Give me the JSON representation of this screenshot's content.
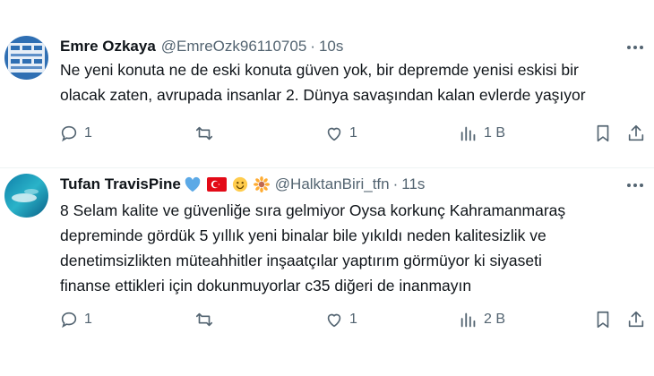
{
  "tweets": [
    {
      "name": "Emre Ozkaya",
      "handle": "@EmreOzk96110705",
      "separator": "·",
      "time": "10s",
      "lines": [
        "Ne yeni konuta ne de eski konuta güven yok, bir depremde yenisi eskisi bir",
        "olacak zaten, avrupada insanlar 2. Dünya savaşından kalan evlerde yaşıyor"
      ],
      "replies": "1",
      "retweets": "",
      "likes": "1",
      "views": "1 B"
    },
    {
      "name": "Tufan TravisPine",
      "handle": "@HalktanBiri_tfn",
      "separator": "·",
      "time": "11s",
      "badges": [
        "blue-heart-icon",
        "turkey-flag-icon",
        "smiley-icon",
        "sunflower-icon"
      ],
      "lines": [
        "8 Selam kalite ve güvenliğe sıra gelmiyor Oysa korkunç Kahramanmaraş",
        "depreminde gördük 5 yıllık yeni binalar bile yıkıldı neden kalitesizlik ve",
        "denetimsizlikten müteahhitler inşaatçılar yaptırım görmüyor ki siyaseti",
        "finanse ettikleri için dokunmuyorlar c35 diğeri de inanmayın"
      ],
      "replies": "1",
      "retweets": "",
      "likes": "1",
      "views": "2 B"
    }
  ],
  "colors": {
    "text": "#0f1419",
    "muted": "#536471",
    "divider": "#eff3f4"
  }
}
